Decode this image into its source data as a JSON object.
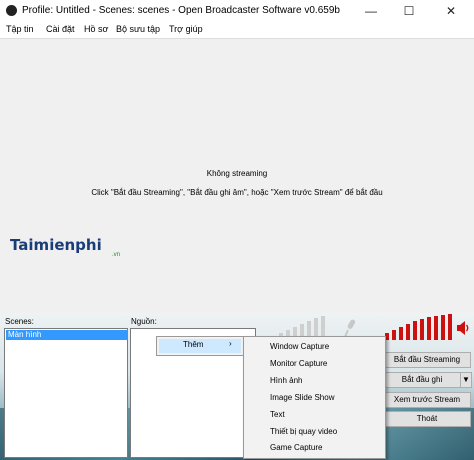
{
  "window": {
    "title": "Profile: Untitled - Scenes: scenes - Open Broadcaster Software v0.659b",
    "minimize": "—",
    "maximize": "☐",
    "close": "✕"
  },
  "menubar": {
    "items": [
      "Tập tin",
      "Cài đặt",
      "Hồ sơ",
      "Bộ sưu tập",
      "Trợ giúp"
    ]
  },
  "preview": {
    "status": "Không streaming",
    "hint": "Click \"Bắt đầu Streaming\", \"Bắt đầu ghi âm\", hoặc \"Xem trước Stream\" để bắt đầu"
  },
  "watermark": {
    "logo": "Taimienphi",
    "sub": ".vn"
  },
  "scenes": {
    "label": "Scenes:",
    "items": [
      "Màn hình"
    ]
  },
  "sources": {
    "label": "Nguồn:"
  },
  "context_menu": {
    "add_label": "Thêm",
    "arrow": "›",
    "submenu": [
      "Window Capture",
      "Monitor Capture",
      "Hình ảnh",
      "Image Slide Show",
      "Text",
      "Thiết bị quay video",
      "Game Capture"
    ]
  },
  "buttons": {
    "start_streaming": "Bắt đầu Streaming",
    "start_recording": "Bắt đầu ghi",
    "record_dropdown": "▼",
    "preview_stream": "Xem trước Stream",
    "exit": "Thoát"
  },
  "icons": {
    "mic": "mic-icon",
    "speaker": "speaker-icon"
  },
  "colors": {
    "mic_meter": "#cfcfcf",
    "desktop_meter": "#cc1111",
    "selection": "#3399ff",
    "menu_highlight": "#cde8ff"
  }
}
